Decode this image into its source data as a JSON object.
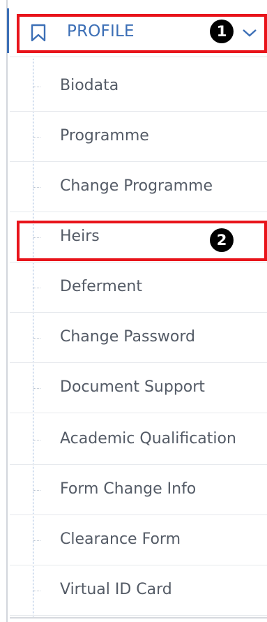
{
  "colors": {
    "accent": "#3c6fb6",
    "highlight": "#e8141b",
    "item_text": "#545b66",
    "marker_bg": "#000000"
  },
  "profile": {
    "label": "PROFILE",
    "icon": "bookmark-icon",
    "toggle_icon": "chevron-down-icon"
  },
  "menu": {
    "items": [
      {
        "label": "Biodata"
      },
      {
        "label": "Programme"
      },
      {
        "label": "Change Programme"
      },
      {
        "label": "Heirs"
      },
      {
        "label": "Deferment"
      },
      {
        "label": "Change Password"
      },
      {
        "label": "Document Support"
      },
      {
        "label": "Academic Qualification"
      },
      {
        "label": "Form Change Info"
      },
      {
        "label": "Clearance Form"
      },
      {
        "label": "Virtual ID Card"
      }
    ]
  },
  "annotations": {
    "marker1": "1",
    "marker2": "2"
  }
}
